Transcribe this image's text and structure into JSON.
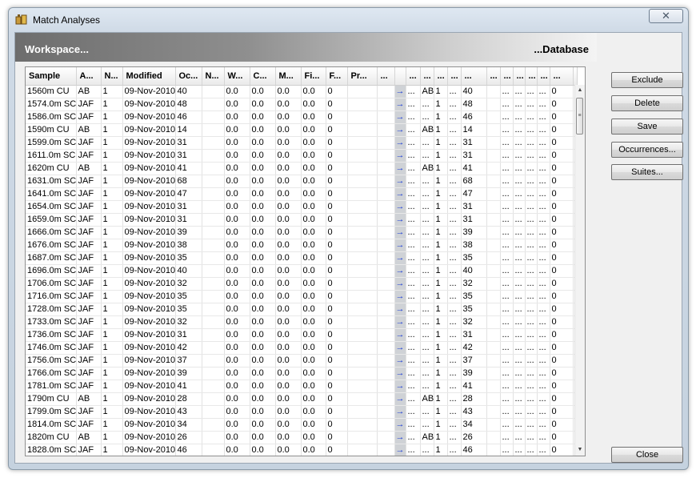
{
  "window": {
    "title": "Match Analyses",
    "close_glyph": "✕"
  },
  "header": {
    "workspace_label": "Workspace...",
    "database_label": "...Database"
  },
  "table": {
    "columns": [
      "Sample",
      "A...",
      "N...",
      "Modified",
      "Oc...",
      "N...",
      "W...",
      "C...",
      "M...",
      "Fi...",
      "F...",
      "Pr...",
      "...",
      "",
      "...",
      "...",
      "...",
      "...",
      "...",
      "...",
      "...",
      "...",
      "...",
      "...",
      "...",
      ""
    ],
    "rows": [
      [
        "1560m CU",
        "AB",
        "1",
        "09-Nov-2010",
        "40",
        "",
        "0.0",
        "0.0",
        "0.0",
        "0.0",
        "0",
        "",
        "",
        "→",
        "...",
        "AB",
        "1",
        "...",
        "40",
        "",
        "...",
        "...",
        "...",
        "...",
        "0",
        ""
      ],
      [
        "1574.0m SC",
        "JAF",
        "1",
        "09-Nov-2010",
        "48",
        "",
        "0.0",
        "0.0",
        "0.0",
        "0.0",
        "0",
        "",
        "",
        "→",
        "...",
        "...",
        "1",
        "...",
        "48",
        "",
        "...",
        "...",
        "...",
        "...",
        "0",
        ""
      ],
      [
        "1586.0m SC",
        "JAF",
        "1",
        "09-Nov-2010",
        "46",
        "",
        "0.0",
        "0.0",
        "0.0",
        "0.0",
        "0",
        "",
        "",
        "→",
        "...",
        "...",
        "1",
        "...",
        "46",
        "",
        "...",
        "...",
        "...",
        "...",
        "0",
        ""
      ],
      [
        "1590m CU",
        "AB",
        "1",
        "09-Nov-2010",
        "14",
        "",
        "0.0",
        "0.0",
        "0.0",
        "0.0",
        "0",
        "",
        "",
        "→",
        "...",
        "AB",
        "1",
        "...",
        "14",
        "",
        "...",
        "...",
        "...",
        "...",
        "0",
        ""
      ],
      [
        "1599.0m SC",
        "JAF",
        "1",
        "09-Nov-2010",
        "31",
        "",
        "0.0",
        "0.0",
        "0.0",
        "0.0",
        "0",
        "",
        "",
        "→",
        "...",
        "...",
        "1",
        "...",
        "31",
        "",
        "...",
        "...",
        "...",
        "...",
        "0",
        ""
      ],
      [
        "1611.0m SC",
        "JAF",
        "1",
        "09-Nov-2010",
        "31",
        "",
        "0.0",
        "0.0",
        "0.0",
        "0.0",
        "0",
        "",
        "",
        "→",
        "...",
        "...",
        "1",
        "...",
        "31",
        "",
        "...",
        "...",
        "...",
        "...",
        "0",
        ""
      ],
      [
        "1620m CU",
        "AB",
        "1",
        "09-Nov-2010",
        "41",
        "",
        "0.0",
        "0.0",
        "0.0",
        "0.0",
        "0",
        "",
        "",
        "→",
        "...",
        "AB",
        "1",
        "...",
        "41",
        "",
        "...",
        "...",
        "...",
        "...",
        "0",
        ""
      ],
      [
        "1631.0m SC",
        "JAF",
        "1",
        "09-Nov-2010",
        "68",
        "",
        "0.0",
        "0.0",
        "0.0",
        "0.0",
        "0",
        "",
        "",
        "→",
        "...",
        "...",
        "1",
        "...",
        "68",
        "",
        "...",
        "...",
        "...",
        "...",
        "0",
        ""
      ],
      [
        "1641.0m SC",
        "JAF",
        "1",
        "09-Nov-2010",
        "47",
        "",
        "0.0",
        "0.0",
        "0.0",
        "0.0",
        "0",
        "",
        "",
        "→",
        "...",
        "...",
        "1",
        "...",
        "47",
        "",
        "...",
        "...",
        "...",
        "...",
        "0",
        ""
      ],
      [
        "1654.0m SC",
        "JAF",
        "1",
        "09-Nov-2010",
        "31",
        "",
        "0.0",
        "0.0",
        "0.0",
        "0.0",
        "0",
        "",
        "",
        "→",
        "...",
        "...",
        "1",
        "...",
        "31",
        "",
        "...",
        "...",
        "...",
        "...",
        "0",
        ""
      ],
      [
        "1659.0m SC",
        "JAF",
        "1",
        "09-Nov-2010",
        "31",
        "",
        "0.0",
        "0.0",
        "0.0",
        "0.0",
        "0",
        "",
        "",
        "→",
        "...",
        "...",
        "1",
        "...",
        "31",
        "",
        "...",
        "...",
        "...",
        "...",
        "0",
        ""
      ],
      [
        "1666.0m SC",
        "JAF",
        "1",
        "09-Nov-2010",
        "39",
        "",
        "0.0",
        "0.0",
        "0.0",
        "0.0",
        "0",
        "",
        "",
        "→",
        "...",
        "...",
        "1",
        "...",
        "39",
        "",
        "...",
        "...",
        "...",
        "...",
        "0",
        ""
      ],
      [
        "1676.0m SC",
        "JAF",
        "1",
        "09-Nov-2010",
        "38",
        "",
        "0.0",
        "0.0",
        "0.0",
        "0.0",
        "0",
        "",
        "",
        "→",
        "...",
        "...",
        "1",
        "...",
        "38",
        "",
        "...",
        "...",
        "...",
        "...",
        "0",
        ""
      ],
      [
        "1687.0m SC",
        "JAF",
        "1",
        "09-Nov-2010",
        "35",
        "",
        "0.0",
        "0.0",
        "0.0",
        "0.0",
        "0",
        "",
        "",
        "→",
        "...",
        "...",
        "1",
        "...",
        "35",
        "",
        "...",
        "...",
        "...",
        "...",
        "0",
        ""
      ],
      [
        "1696.0m SC",
        "JAF",
        "1",
        "09-Nov-2010",
        "40",
        "",
        "0.0",
        "0.0",
        "0.0",
        "0.0",
        "0",
        "",
        "",
        "→",
        "...",
        "...",
        "1",
        "...",
        "40",
        "",
        "...",
        "...",
        "...",
        "...",
        "0",
        ""
      ],
      [
        "1706.0m SC",
        "JAF",
        "1",
        "09-Nov-2010",
        "32",
        "",
        "0.0",
        "0.0",
        "0.0",
        "0.0",
        "0",
        "",
        "",
        "→",
        "...",
        "...",
        "1",
        "...",
        "32",
        "",
        "...",
        "...",
        "...",
        "...",
        "0",
        ""
      ],
      [
        "1716.0m SC",
        "JAF",
        "1",
        "09-Nov-2010",
        "35",
        "",
        "0.0",
        "0.0",
        "0.0",
        "0.0",
        "0",
        "",
        "",
        "→",
        "...",
        "...",
        "1",
        "...",
        "35",
        "",
        "...",
        "...",
        "...",
        "...",
        "0",
        ""
      ],
      [
        "1728.0m SC",
        "JAF",
        "1",
        "09-Nov-2010",
        "35",
        "",
        "0.0",
        "0.0",
        "0.0",
        "0.0",
        "0",
        "",
        "",
        "→",
        "...",
        "...",
        "1",
        "...",
        "35",
        "",
        "...",
        "...",
        "...",
        "...",
        "0",
        ""
      ],
      [
        "1733.0m SC",
        "JAF",
        "1",
        "09-Nov-2010",
        "32",
        "",
        "0.0",
        "0.0",
        "0.0",
        "0.0",
        "0",
        "",
        "",
        "→",
        "...",
        "...",
        "1",
        "...",
        "32",
        "",
        "...",
        "...",
        "...",
        "...",
        "0",
        ""
      ],
      [
        "1736.0m SC",
        "JAF",
        "1",
        "09-Nov-2010",
        "31",
        "",
        "0.0",
        "0.0",
        "0.0",
        "0.0",
        "0",
        "",
        "",
        "→",
        "...",
        "...",
        "1",
        "...",
        "31",
        "",
        "...",
        "...",
        "...",
        "...",
        "0",
        ""
      ],
      [
        "1746.0m SC",
        "JAF",
        "1",
        "09-Nov-2010",
        "42",
        "",
        "0.0",
        "0.0",
        "0.0",
        "0.0",
        "0",
        "",
        "",
        "→",
        "...",
        "...",
        "1",
        "...",
        "42",
        "",
        "...",
        "...",
        "...",
        "...",
        "0",
        ""
      ],
      [
        "1756.0m SC",
        "JAF",
        "1",
        "09-Nov-2010",
        "37",
        "",
        "0.0",
        "0.0",
        "0.0",
        "0.0",
        "0",
        "",
        "",
        "→",
        "...",
        "...",
        "1",
        "...",
        "37",
        "",
        "...",
        "...",
        "...",
        "...",
        "0",
        ""
      ],
      [
        "1766.0m SC",
        "JAF",
        "1",
        "09-Nov-2010",
        "39",
        "",
        "0.0",
        "0.0",
        "0.0",
        "0.0",
        "0",
        "",
        "",
        "→",
        "...",
        "...",
        "1",
        "...",
        "39",
        "",
        "...",
        "...",
        "...",
        "...",
        "0",
        ""
      ],
      [
        "1781.0m SC",
        "JAF",
        "1",
        "09-Nov-2010",
        "41",
        "",
        "0.0",
        "0.0",
        "0.0",
        "0.0",
        "0",
        "",
        "",
        "→",
        "...",
        "...",
        "1",
        "...",
        "41",
        "",
        "...",
        "...",
        "...",
        "...",
        "0",
        ""
      ],
      [
        "1790m CU",
        "AB",
        "1",
        "09-Nov-2010",
        "28",
        "",
        "0.0",
        "0.0",
        "0.0",
        "0.0",
        "0",
        "",
        "",
        "→",
        "...",
        "AB",
        "1",
        "...",
        "28",
        "",
        "...",
        "...",
        "...",
        "...",
        "0",
        ""
      ],
      [
        "1799.0m SC",
        "JAF",
        "1",
        "09-Nov-2010",
        "43",
        "",
        "0.0",
        "0.0",
        "0.0",
        "0.0",
        "0",
        "",
        "",
        "→",
        "...",
        "...",
        "1",
        "...",
        "43",
        "",
        "...",
        "...",
        "...",
        "...",
        "0",
        ""
      ],
      [
        "1814.0m SC",
        "JAF",
        "1",
        "09-Nov-2010",
        "34",
        "",
        "0.0",
        "0.0",
        "0.0",
        "0.0",
        "0",
        "",
        "",
        "→",
        "...",
        "...",
        "1",
        "...",
        "34",
        "",
        "...",
        "...",
        "...",
        "...",
        "0",
        ""
      ],
      [
        "1820m CU",
        "AB",
        "1",
        "09-Nov-2010",
        "26",
        "",
        "0.0",
        "0.0",
        "0.0",
        "0.0",
        "0",
        "",
        "",
        "→",
        "...",
        "AB",
        "1",
        "...",
        "26",
        "",
        "...",
        "...",
        "...",
        "...",
        "0",
        ""
      ],
      [
        "1828.0m SC",
        "JAF",
        "1",
        "09-Nov-2010",
        "46",
        "",
        "0.0",
        "0.0",
        "0.0",
        "0.0",
        "0",
        "",
        "",
        "→",
        "...",
        "...",
        "1",
        "...",
        "46",
        "",
        "...",
        "...",
        "...",
        "...",
        "0",
        ""
      ]
    ]
  },
  "scrollbar": {
    "up_glyph": "▲",
    "down_glyph": "▼",
    "grip_glyph": "≡"
  },
  "buttons": {
    "exclude": "Exclude",
    "delete": "Delete",
    "save": "Save",
    "occurrences": "Occurrences...",
    "suites": "Suites...",
    "close": "Close"
  },
  "colors": {
    "arrow": "#1a3cd6",
    "header_band_dark": "#6d6d6d"
  }
}
